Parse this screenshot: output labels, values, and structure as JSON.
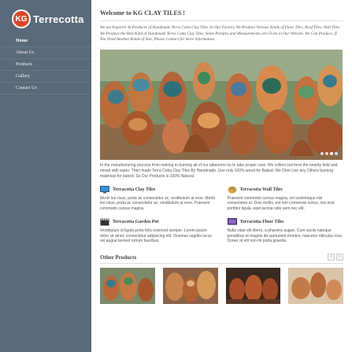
{
  "brand": {
    "badge": "KG",
    "name": "Terrecotta",
    "accent": "#d9472b"
  },
  "nav": {
    "items": [
      {
        "label": "Home"
      },
      {
        "label": "About Us"
      },
      {
        "label": "Products"
      },
      {
        "label": "Gallery"
      },
      {
        "label": "Contact Us"
      }
    ]
  },
  "main": {
    "title": "Welcome to KG CLAY TILES !",
    "intro": "We are Exporter & Producer of Handmade Terra Cotta Clay Tiles. In Our Factory We Produce Various Kinds of Floor Tiles, Roof Tiles, Wall Tiles. We Produce the Best Kind of Handmade Terra Cotta Clay Tiles. Some Pictures and Measurements are Given in Our Website. We Can Produce, If You Need Another Kinds of Size, Please Contact for more information.",
    "description": "In the manufacturing process from making to burning all of our labourers try to take proper care. We collect soil form the nearby field and mixed with water. Then made Terra Cotta Clay Tiles By Handmade. Use only 100% wood for Baked. We Dont Use any Others burning materials for baked. So Our Products is 100% Natural."
  },
  "features": [
    {
      "icon": "monitor-icon",
      "title": "Terracotta Clay Tiles",
      "text": "Morbi leo risus, porta ac consectetur ac, vestibulum at eros. Morbi leo risus, porta ac consectetur ac, vestibulum at eros. Praesent commodo cursus magna."
    },
    {
      "icon": "palette-icon",
      "title": "Terracotta Wall Tiles",
      "text": "Praesent commodo cursus magna, vel scelerisque nisl consectetur et. Duis mollis, est non commodo luctus, nisi erat porttitor ligula, eget lacinia odio sem nec elit."
    },
    {
      "icon": "clapperboard-icon",
      "title": "Terracotta Garden Pot",
      "text": "Vestibulum id ligula porta felis euismod semper. Lorem ipsum dolor sit amet, consectetur adipiscing elit. Vivamus sagittis lacus vel augue laoreet rutrum faucibus."
    },
    {
      "icon": "screen-icon",
      "title": "Terracotta Floor Tiles",
      "text": "Nulla vitae elit libero, a pharetra augue. Cum sociis natoque penatibus et magnis dis parturient montes, nascetur ridiculus mus. Donec id elit non mi porta gravida."
    }
  ],
  "other": {
    "title": "Other Products",
    "prev": "‹",
    "next": "›"
  },
  "slider": {
    "dots": 4,
    "active": 3
  }
}
